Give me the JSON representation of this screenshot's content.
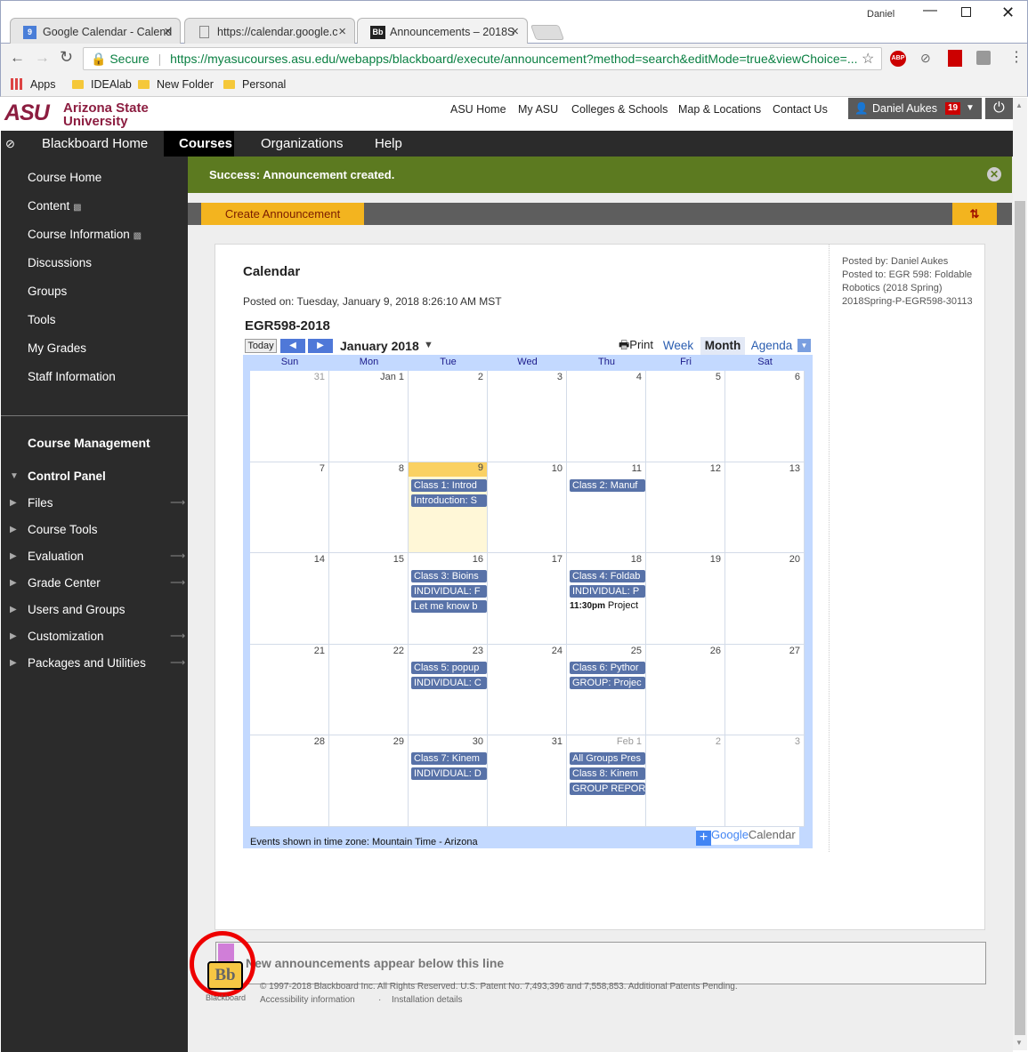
{
  "browser": {
    "tabs": [
      {
        "title": "Google Calendar - Calend",
        "favicon": "9"
      },
      {
        "title": "https://calendar.google.c",
        "favicon": ""
      },
      {
        "title": "Announcements – 2018S",
        "favicon": "Bb"
      }
    ],
    "user": "Daniel",
    "secure_label": "Secure",
    "url": "https://myasucourses.asu.edu/webapps/blackboard/execute/announcement?method=search&editMode=true&viewChoice=...",
    "bookmarks": [
      "Apps",
      "IDEAlab",
      "New Folder",
      "Personal"
    ]
  },
  "asu": {
    "logo_mark": "ASU",
    "logo_line1": "Arizona State",
    "logo_line2": "University",
    "links": [
      "ASU Home",
      "My ASU",
      "Colleges & Schools",
      "Map & Locations",
      "Contact Us"
    ],
    "user_name": "Daniel Aukes",
    "notif_count": "19"
  },
  "nav": {
    "tabs": [
      "Blackboard Home",
      "Courses",
      "Organizations",
      "Help"
    ]
  },
  "sidebar": {
    "items": [
      "Course Home",
      "Content",
      "Course Information",
      "Discussions",
      "Groups",
      "Tools",
      "My Grades",
      "Staff Information"
    ],
    "mgmt_title": "Course Management",
    "control_panel": "Control Panel",
    "cp_items": [
      "Files",
      "Course Tools",
      "Evaluation",
      "Grade Center",
      "Users and Groups",
      "Customization",
      "Packages and Utilities"
    ]
  },
  "main": {
    "success": "Success: Announcement created.",
    "create_btn": "Create Announcement",
    "ann_title": "Calendar",
    "posted_on": "Posted on: Tuesday, January 9, 2018 8:26:10 AM MST",
    "posted_by": "Posted by: Daniel Aukes",
    "posted_to": "Posted to: EGR 598: Foldable Robotics (2018 Spring) 2018Spring-P-EGR598-30113",
    "new_line": "New announcements appear below this line"
  },
  "calendar": {
    "title": "EGR598-2018",
    "today": "Today",
    "month": "January 2018",
    "print": "Print",
    "views": [
      "Week",
      "Month",
      "Agenda"
    ],
    "days": [
      "Sun",
      "Mon",
      "Tue",
      "Wed",
      "Thu",
      "Fri",
      "Sat"
    ],
    "weeks": [
      [
        "31",
        "Jan 1",
        "2",
        "3",
        "4",
        "5",
        "6"
      ],
      [
        "7",
        "8",
        "9",
        "10",
        "11",
        "12",
        "13"
      ],
      [
        "14",
        "15",
        "16",
        "17",
        "18",
        "19",
        "20"
      ],
      [
        "21",
        "22",
        "23",
        "24",
        "25",
        "26",
        "27"
      ],
      [
        "28",
        "29",
        "30",
        "31",
        "Feb 1",
        "2",
        "3"
      ]
    ],
    "events": [
      {
        "w": 1,
        "d": 2,
        "slot": 0,
        "text": "Class 1: Introd"
      },
      {
        "w": 1,
        "d": 2,
        "slot": 1,
        "text": "Introduction: S"
      },
      {
        "w": 1,
        "d": 4,
        "slot": 0,
        "text": "Class 2: Manuf"
      },
      {
        "w": 2,
        "d": 2,
        "slot": 0,
        "text": "Class 3: Bioins"
      },
      {
        "w": 2,
        "d": 2,
        "slot": 1,
        "text": "INDIVIDUAL: F"
      },
      {
        "w": 2,
        "d": 2,
        "slot": 2,
        "text": "Let me know b"
      },
      {
        "w": 2,
        "d": 4,
        "slot": 0,
        "text": "Class 4: Foldab"
      },
      {
        "w": 2,
        "d": 4,
        "slot": 1,
        "text": "INDIVIDUAL: P"
      },
      {
        "w": 2,
        "d": 4,
        "slot": 2,
        "text": "Project",
        "time": "11:30pm",
        "plain": true
      },
      {
        "w": 3,
        "d": 2,
        "slot": 0,
        "text": "Class 5: popup"
      },
      {
        "w": 3,
        "d": 2,
        "slot": 1,
        "text": "INDIVIDUAL: C"
      },
      {
        "w": 3,
        "d": 4,
        "slot": 0,
        "text": "Class 6: Pythor"
      },
      {
        "w": 3,
        "d": 4,
        "slot": 1,
        "text": "GROUP: Projec"
      },
      {
        "w": 4,
        "d": 2,
        "slot": 0,
        "text": "Class 7: Kinem"
      },
      {
        "w": 4,
        "d": 2,
        "slot": 1,
        "text": "INDIVIDUAL: D"
      },
      {
        "w": 4,
        "d": 4,
        "slot": 0,
        "text": "All Groups Pres"
      },
      {
        "w": 4,
        "d": 4,
        "slot": 1,
        "text": "Class 8: Kinem"
      },
      {
        "w": 4,
        "d": 4,
        "slot": 2,
        "text": "GROUP REPORT"
      }
    ],
    "timezone": "Events shown in time zone: Mountain Time - Arizona",
    "gcal_google": "Google",
    "gcal_calendar": "Calendar"
  },
  "footer": {
    "bb_logo": "Bb",
    "bb_word": "Blackboard",
    "copyright": "© 1997-2018 Blackboard Inc. All Rights Reserved. U.S. Patent No. 7,493,396 and 7,558,853. Additional Patents Pending.",
    "accessibility": "Accessibility information",
    "install": "Installation details"
  },
  "colors": {
    "success": "#5c7a20",
    "accent": "#f3b41f",
    "asu_maroon": "#8c1d40",
    "event": "#5872a8"
  }
}
